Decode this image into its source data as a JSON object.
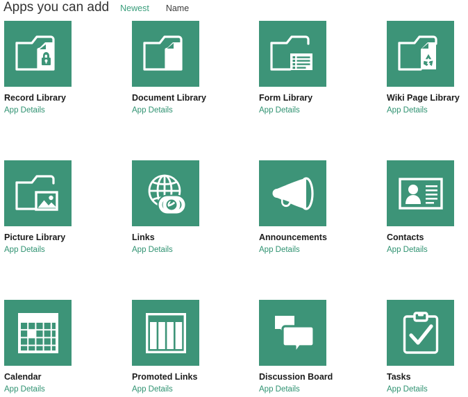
{
  "header": {
    "title": "Apps you can add",
    "sort": [
      {
        "label": "Newest",
        "active": true
      },
      {
        "label": "Name",
        "active": false
      }
    ]
  },
  "theme": {
    "tile_color": "#3d9478",
    "link_color": "#2f9271",
    "title_color": "#333333",
    "name_color": "#1b1b1b",
    "background": "#ffffff"
  },
  "details_label": "App Details",
  "grid": {
    "columns": 4,
    "rows": 3
  },
  "apps": [
    {
      "name": "Record Library",
      "icon": "folder-lock-icon",
      "details": "App Details"
    },
    {
      "name": "Document Library",
      "icon": "folder-document-icon",
      "details": "App Details"
    },
    {
      "name": "Form Library",
      "icon": "folder-form-icon",
      "details": "App Details"
    },
    {
      "name": "Wiki Page Library",
      "icon": "folder-recycle-icon",
      "details": "App Details"
    },
    {
      "name": "Picture Library",
      "icon": "folder-picture-icon",
      "details": "App Details"
    },
    {
      "name": "Links",
      "icon": "globe-chain-icon",
      "details": "App Details"
    },
    {
      "name": "Announcements",
      "icon": "megaphone-icon",
      "details": "App Details"
    },
    {
      "name": "Contacts",
      "icon": "contact-card-icon",
      "details": "App Details"
    },
    {
      "name": "Calendar",
      "icon": "calendar-grid-icon",
      "details": "App Details"
    },
    {
      "name": "Promoted Links",
      "icon": "columns-tiles-icon",
      "details": "App Details"
    },
    {
      "name": "Discussion Board",
      "icon": "speech-bubbles-icon",
      "details": "App Details"
    },
    {
      "name": "Tasks",
      "icon": "clipboard-check-icon",
      "details": "App Details"
    }
  ]
}
